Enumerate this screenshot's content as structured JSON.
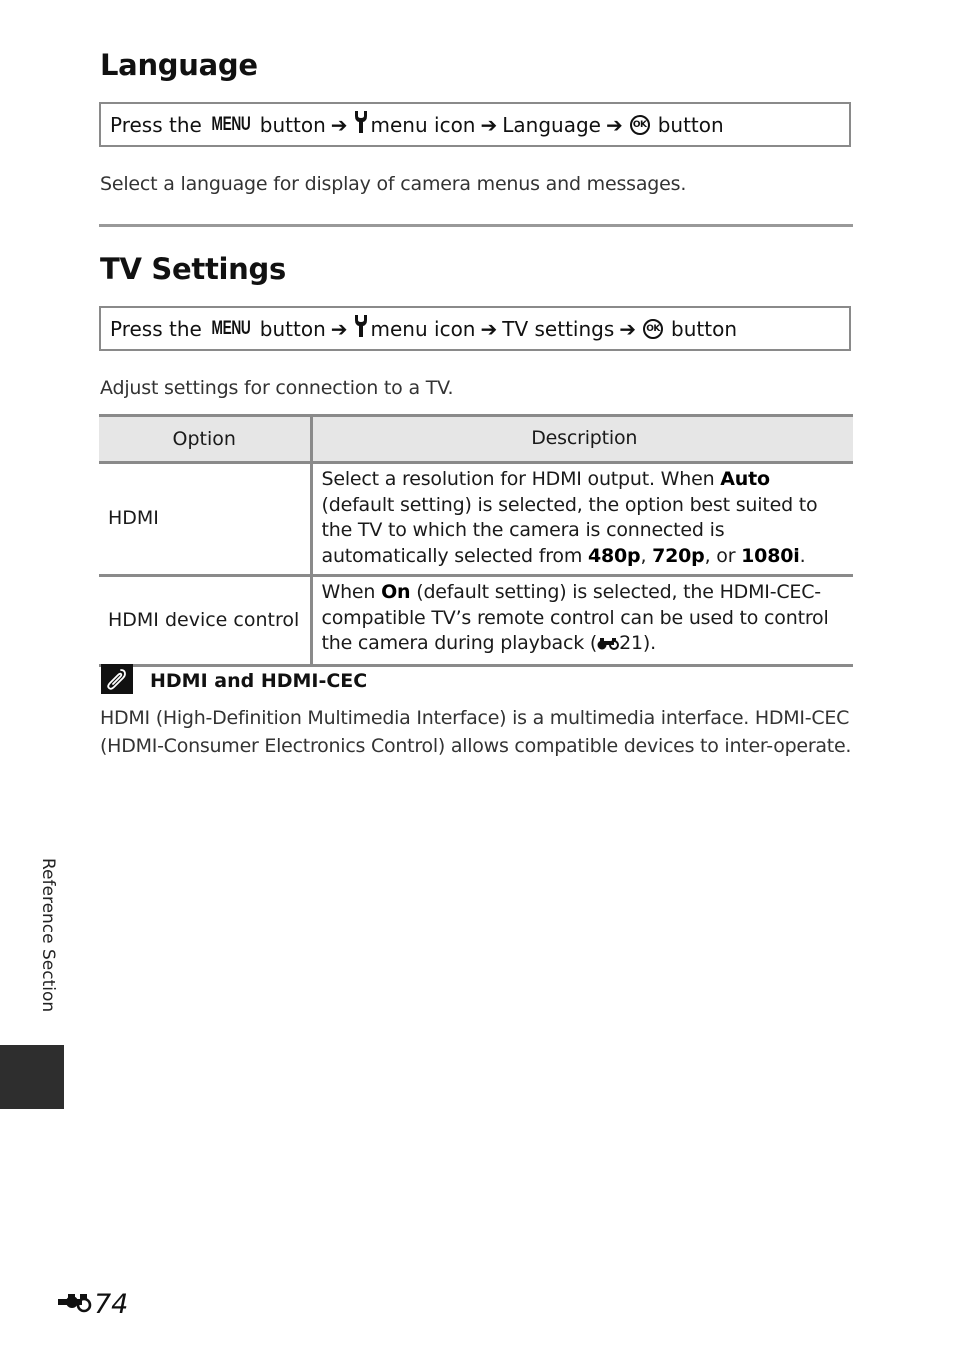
{
  "language": {
    "heading": "Language",
    "procedure": {
      "prefix": "Press the",
      "menu_button": "MENU",
      "button_word": "button",
      "arrow": "➔",
      "menu_icon_label": "menu icon",
      "item": "Language",
      "ok_glyph": "OK",
      "suffix": "button"
    },
    "description": "Select a language for display of camera menus and messages."
  },
  "tv_settings": {
    "heading": "TV Settings",
    "procedure": {
      "prefix": "Press the",
      "menu_button": "MENU",
      "button_word": "button",
      "arrow": "➔",
      "menu_icon_label": "menu icon",
      "item": "TV settings",
      "ok_glyph": "OK",
      "suffix": "button"
    },
    "description": "Adjust settings for connection to a TV.",
    "table": {
      "headers": [
        "Option",
        "Description"
      ],
      "rows": [
        {
          "option": "HDMI",
          "desc": {
            "t1": "Select a resolution for HDMI output. When ",
            "b1": "Auto",
            "t2": " (default setting) is selected, the option best suited to the TV to which the camera is connected is automatically selected from ",
            "b2": "480p",
            "t3": ", ",
            "b3": "720p",
            "t4": ", or ",
            "b4": "1080i",
            "t5": "."
          }
        },
        {
          "option": "HDMI device control",
          "desc": {
            "t1": "When ",
            "b1": "On",
            "t2": " (default setting) is selected, the HDMI-CEC-compatible TV’s remote control can be used to control the camera during playback (",
            "ref": "21",
            "t3": ")."
          }
        }
      ]
    }
  },
  "note": {
    "icon": "paperclip-note-icon",
    "title": "HDMI and HDMI-CEC",
    "line1": "HDMI (High-Definition Multimedia Interface) is a multimedia interface. HDMI-CEC",
    "line2": "(HDMI-Consumer Electronics Control) allows compatible devices to inter-operate."
  },
  "side_tab": {
    "label": "Reference Section",
    "color": "#2e2e2e"
  },
  "footer": {
    "section_icon": "reference-section-icon",
    "page_number": "74"
  }
}
